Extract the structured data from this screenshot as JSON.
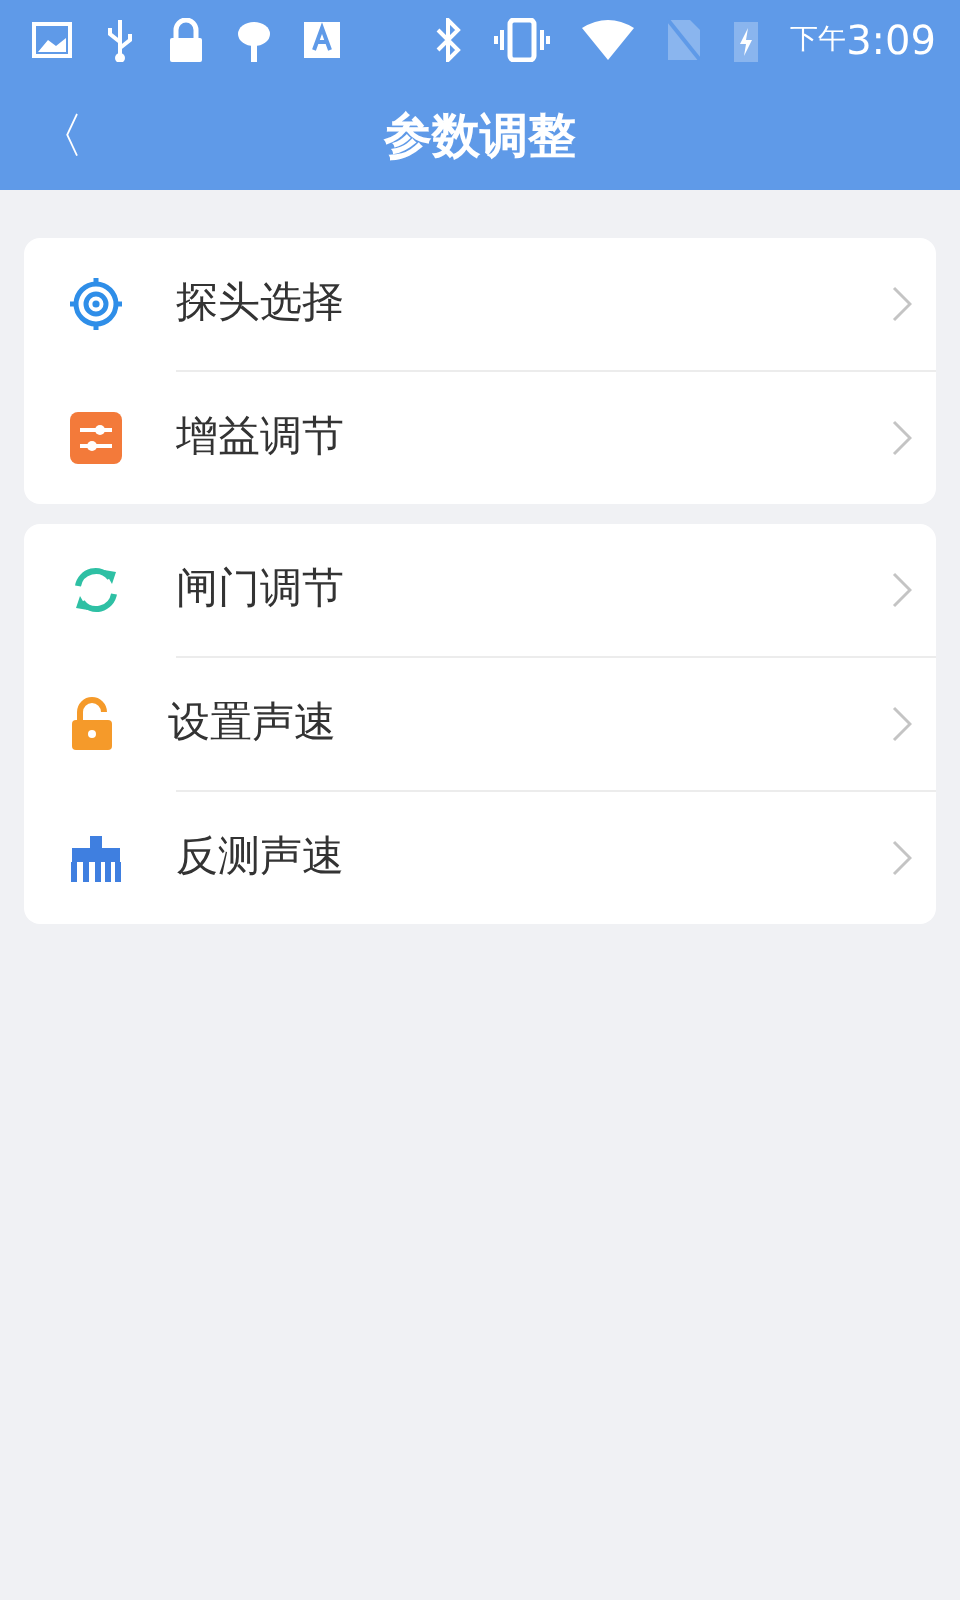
{
  "status_bar": {
    "time_prefix": "下午",
    "time": "3:09"
  },
  "header": {
    "back": "〈",
    "title": "参数调整"
  },
  "groups": [
    {
      "items": [
        {
          "kind": "target",
          "label": "探头选择"
        },
        {
          "kind": "sliders",
          "label": "增益调节"
        }
      ]
    },
    {
      "items": [
        {
          "kind": "refresh",
          "label": "闸门调节"
        },
        {
          "kind": "lock",
          "label": "设置声速"
        },
        {
          "kind": "comb",
          "label": "反测声速"
        }
      ]
    }
  ]
}
